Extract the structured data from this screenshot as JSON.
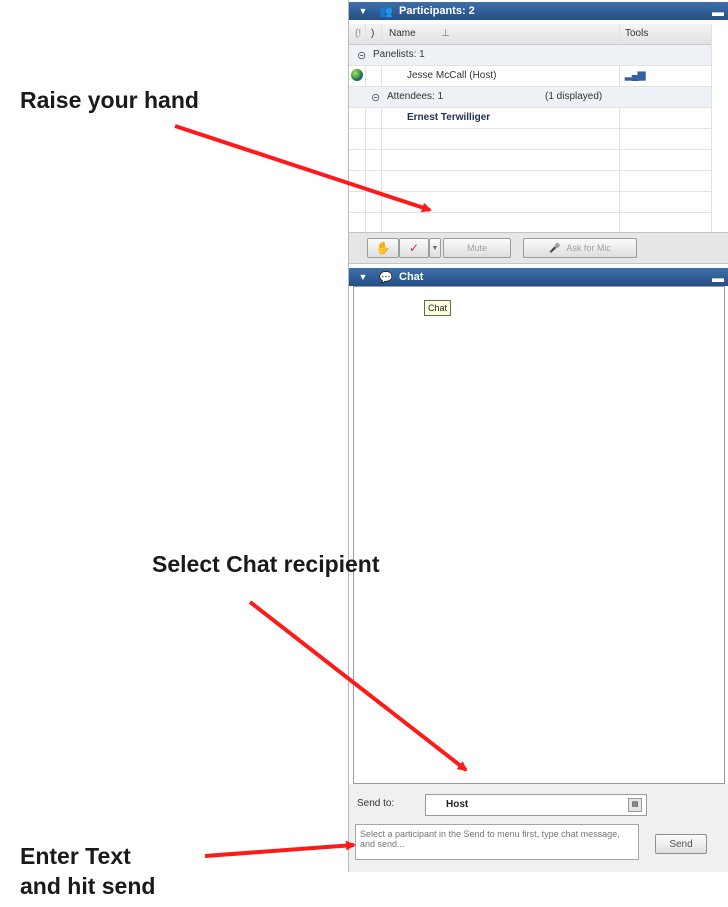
{
  "participants": {
    "title": "Participants: 2",
    "columns": {
      "status_glyph": "(!",
      "sort_glyph": ")",
      "name": "Name",
      "name_sort": "⊥",
      "tools": "Tools"
    },
    "panelists_group": "Panelists: 1",
    "panelists": [
      {
        "name": "Jesse McCall (Host)",
        "tool_icon": "signal-bars-icon"
      }
    ],
    "attendees_group": "Attendees: 1",
    "attendees_displayed": "(1 displayed)",
    "attendees": [
      {
        "name": "Ernest Terwilliger"
      }
    ]
  },
  "toolbar": {
    "mute_label": "Mute",
    "ask_label": "Ask for Mic"
  },
  "chat": {
    "title": "Chat",
    "tooltip": "Chat",
    "send_to_label": "Send to:",
    "send_to_value": "Host",
    "input_placeholder": "Select a participant in the Send to menu first, type chat message, and send...",
    "send_button": "Send"
  },
  "annotations": {
    "raise_hand": "Raise your hand",
    "select_recipient": "Select Chat recipient",
    "enter_text_line1": "Enter Text",
    "enter_text_line2": "and hit send"
  },
  "colors": {
    "header_blue": "#2b5791",
    "arrow_red": "#ff1a1a",
    "group_row": "#eef1f6"
  }
}
